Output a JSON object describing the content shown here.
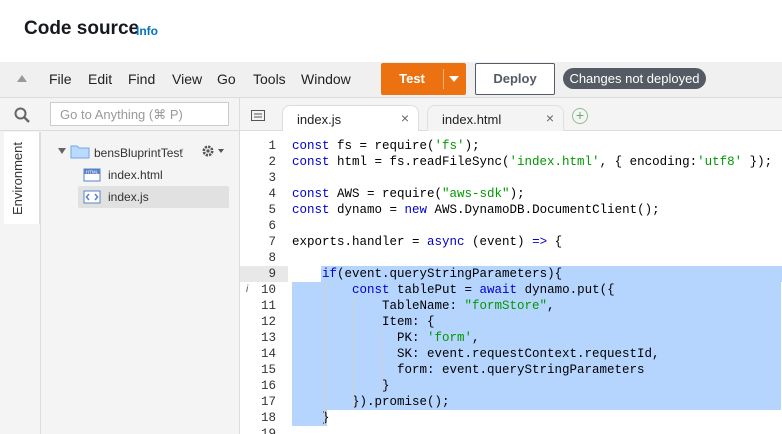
{
  "header": {
    "title": "Code source",
    "info_link": "Info"
  },
  "menubar": {
    "items": [
      "File",
      "Edit",
      "Find",
      "View",
      "Go",
      "Tools",
      "Window"
    ],
    "test_label": "Test",
    "deploy_label": "Deploy",
    "status_badge": "Changes not deployed"
  },
  "sidebar": {
    "search_placeholder": "Go to Anything (⌘ P)",
    "tab_label": "Environment",
    "folder": {
      "name": "bensBluprintTest",
      "suffix": "/"
    },
    "files": [
      {
        "name": "index.html"
      },
      {
        "name": "index.js"
      }
    ]
  },
  "editor_tabs": [
    {
      "label": "index.js",
      "close": "×"
    },
    {
      "label": "index.html",
      "close": "×"
    }
  ],
  "add_tab": "+",
  "code_lines": [
    {
      "n": "1",
      "segs": [
        [
          "kw",
          "const"
        ],
        [
          "",
          "&nbsp;fs = require("
        ],
        [
          "str",
          "'fs'"
        ],
        [
          "",
          ");"
        ]
      ]
    },
    {
      "n": "2",
      "segs": [
        [
          "kw",
          "const"
        ],
        [
          "",
          "&nbsp;html = fs.readFileSync("
        ],
        [
          "str",
          "'index.html'"
        ],
        [
          "",
          ", { encoding:"
        ],
        [
          "str",
          "'utf8'"
        ],
        [
          "",
          " });"
        ]
      ]
    },
    {
      "n": "3",
      "segs": []
    },
    {
      "n": "4",
      "segs": [
        [
          "kw",
          "const"
        ],
        [
          "",
          "&nbsp;AWS = require("
        ],
        [
          "str",
          "\"aws-sdk\""
        ],
        [
          "",
          ");"
        ]
      ]
    },
    {
      "n": "5",
      "segs": [
        [
          "kw",
          "const"
        ],
        [
          "",
          "&nbsp;dynamo = "
        ],
        [
          "kw",
          "new"
        ],
        [
          "",
          " AWS.DynamoDB.DocumentClient();"
        ]
      ]
    },
    {
      "n": "6",
      "segs": []
    },
    {
      "n": "7",
      "segs": [
        [
          "",
          "exports.handler = "
        ],
        [
          "kw",
          "async"
        ],
        [
          "",
          " (event) "
        ],
        [
          "kw",
          "=>"
        ],
        [
          "",
          " {"
        ]
      ]
    },
    {
      "n": "8",
      "segs": []
    },
    {
      "n": "9",
      "segs": [
        [
          "",
          "    "
        ],
        [
          "kw",
          "if"
        ],
        [
          "",
          "(event.queryStringParameters){"
        ]
      ]
    },
    {
      "n": "10",
      "segs": [
        [
          "",
          "        "
        ],
        [
          "kw",
          "const"
        ],
        [
          "",
          " tablePut = "
        ],
        [
          "kw",
          "await"
        ],
        [
          "",
          " dynamo.put({"
        ]
      ]
    },
    {
      "n": "11",
      "segs": [
        [
          "",
          "            TableName: "
        ],
        [
          "str",
          "\"formStore\""
        ],
        [
          "",
          ","
        ]
      ]
    },
    {
      "n": "12",
      "segs": [
        [
          "",
          "            Item: {"
        ]
      ]
    },
    {
      "n": "13",
      "segs": [
        [
          "",
          "              PK: "
        ],
        [
          "str",
          "'form'"
        ],
        [
          "",
          ","
        ]
      ]
    },
    {
      "n": "14",
      "segs": [
        [
          "",
          "              SK: event.requestContext.requestId,"
        ]
      ]
    },
    {
      "n": "15",
      "segs": [
        [
          "",
          "              form: event.queryStringParameters"
        ]
      ]
    },
    {
      "n": "16",
      "segs": [
        [
          "",
          "            }"
        ]
      ]
    },
    {
      "n": "17",
      "segs": [
        [
          "",
          "        }).promise();"
        ]
      ]
    },
    {
      "n": "18",
      "segs": [
        [
          "",
          "    }"
        ]
      ]
    },
    {
      "n": "19",
      "segs": []
    }
  ],
  "colors": {
    "test_button": "#ec7211",
    "keyword": "#0000cc",
    "string": "#009900",
    "selection": "#b5d5ff"
  }
}
